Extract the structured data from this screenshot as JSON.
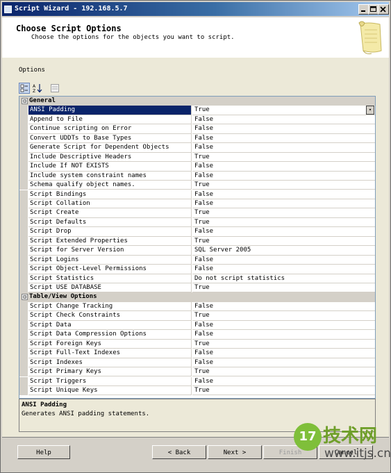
{
  "window": {
    "title": "Script Wizard - 192.168.5.7"
  },
  "header": {
    "title": "Choose Script Options",
    "subtitle": "Choose the options for the objects you want to script."
  },
  "content": {
    "options_label": "Options"
  },
  "toolbar": {
    "categorized_icon": "categorized-icon",
    "alphabetical_icon": "sort-az-icon",
    "property_pages_icon": "property-pages-icon"
  },
  "grid": {
    "categories": [
      {
        "label": "General",
        "expander": "⊟",
        "rows": [
          {
            "name": "ANSI Padding",
            "value": "True"
          },
          {
            "name": "Append to File",
            "value": "False"
          },
          {
            "name": "Continue scripting on Error",
            "value": "False"
          },
          {
            "name": "Convert UDDTs to Base Types",
            "value": "False"
          },
          {
            "name": "Generate Script for Dependent Objects",
            "value": "False"
          },
          {
            "name": "Include Descriptive Headers",
            "value": "True"
          },
          {
            "name": "Include If NOT EXISTS",
            "value": "False"
          },
          {
            "name": "Include system constraint names",
            "value": "False"
          },
          {
            "name": "Schema qualify object names.",
            "value": "True"
          },
          {
            "name": "Script Bindings",
            "value": "False"
          },
          {
            "name": "Script Collation",
            "value": "False"
          },
          {
            "name": "Script Create",
            "value": "True"
          },
          {
            "name": "Script Defaults",
            "value": "True"
          },
          {
            "name": "Script Drop",
            "value": "False"
          },
          {
            "name": "Script Extended Properties",
            "value": "True"
          },
          {
            "name": "Script for Server Version",
            "value": "SQL Server 2005"
          },
          {
            "name": "Script Logins",
            "value": "False"
          },
          {
            "name": "Script Object-Level Permissions",
            "value": "False"
          },
          {
            "name": "Script Statistics",
            "value": "Do not script statistics"
          },
          {
            "name": "Script USE DATABASE",
            "value": "True"
          }
        ]
      },
      {
        "label": "Table/View Options",
        "expander": "⊟",
        "rows": [
          {
            "name": "Script Change Tracking",
            "value": "False"
          },
          {
            "name": "Script Check Constraints",
            "value": "True"
          },
          {
            "name": "Script Data",
            "value": "False"
          },
          {
            "name": "Script Data Compression Options",
            "value": "False"
          },
          {
            "name": "Script Foreign Keys",
            "value": "True"
          },
          {
            "name": "Script Full-Text Indexes",
            "value": "False"
          },
          {
            "name": "Script Indexes",
            "value": "False"
          },
          {
            "name": "Script Primary Keys",
            "value": "True"
          },
          {
            "name": "Script Triggers",
            "value": "False"
          },
          {
            "name": "Script Unique Keys",
            "value": "True"
          }
        ]
      }
    ],
    "dropdown_glyph": "▾"
  },
  "description": {
    "title": "ANSI Padding",
    "text": "Generates ANSI padding statements."
  },
  "buttons": {
    "help": "Help",
    "back": "< Back",
    "next": "Next >",
    "finish": "Finish",
    "cancel": "Cancel"
  },
  "watermark": {
    "logo": "17",
    "brand": "技术网",
    "url": "www.itjs.cn"
  },
  "colors": {
    "selection": "#0a246a",
    "title_bar": "#0a246a",
    "panel": "#ece9d8"
  }
}
